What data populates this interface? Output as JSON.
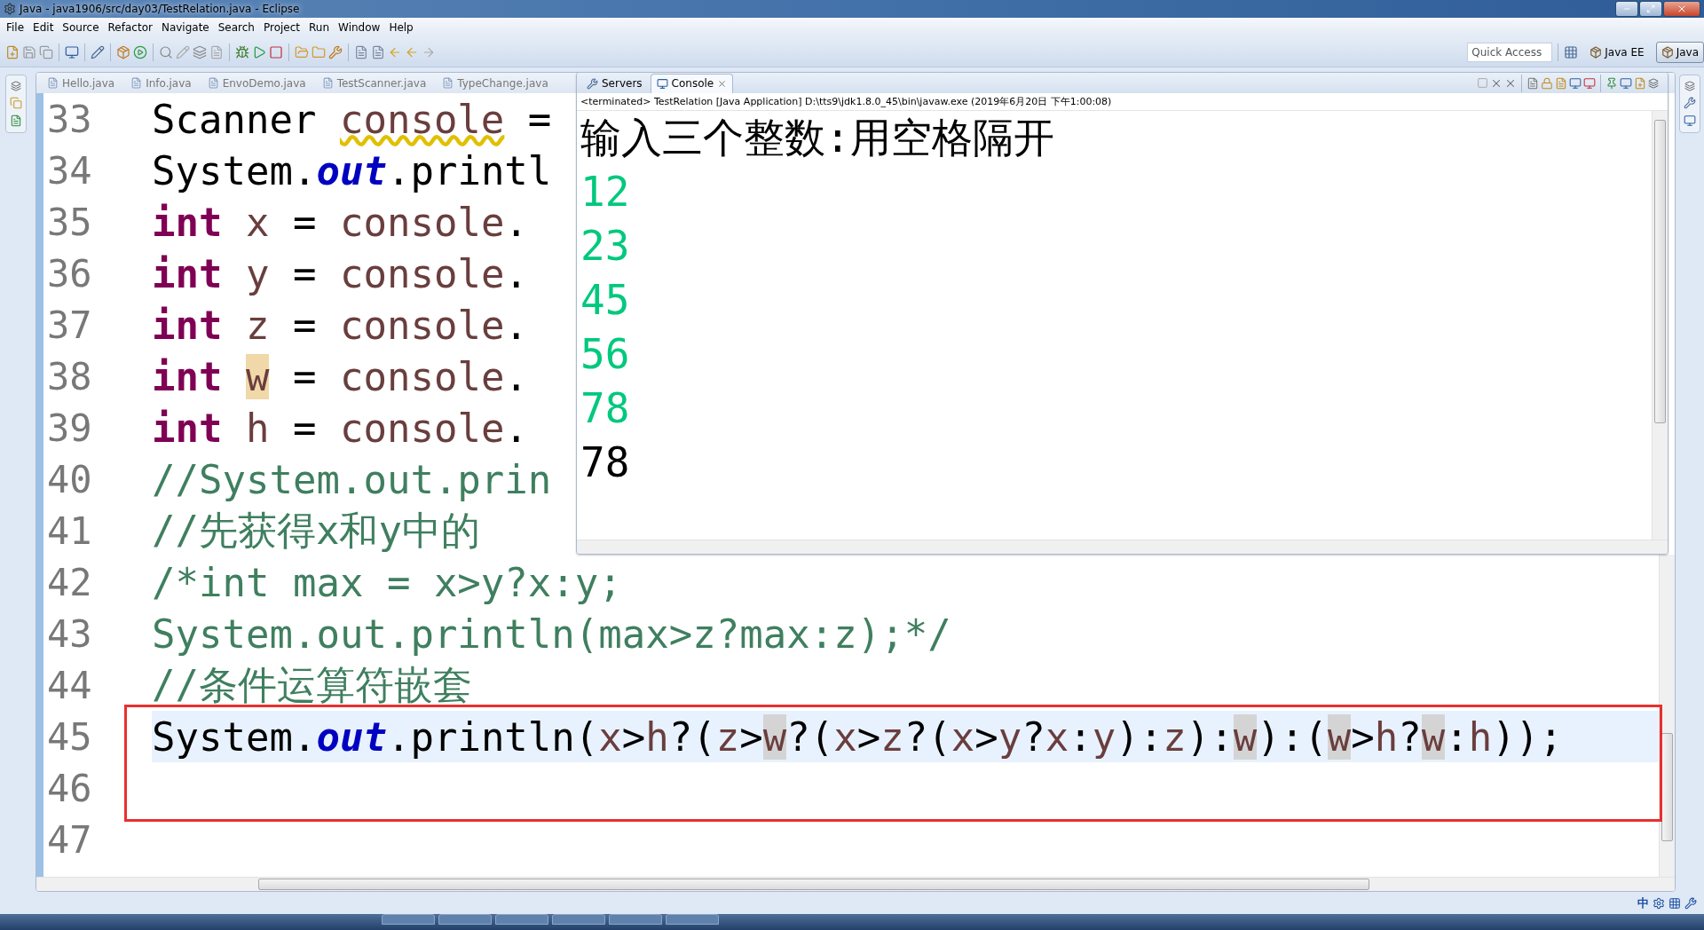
{
  "window": {
    "title": "Java - java1906/src/day03/TestRelation.java - Eclipse"
  },
  "menu": [
    "File",
    "Edit",
    "Source",
    "Refactor",
    "Navigate",
    "Search",
    "Project",
    "Run",
    "Window",
    "Help"
  ],
  "quick_access": {
    "placeholder": "Quick Access"
  },
  "perspectives": [
    {
      "label": "Java EE",
      "selected": false
    },
    {
      "label": "Java",
      "selected": true
    }
  ],
  "editor_tabs": [
    {
      "label": "Hello.java",
      "selected": false
    },
    {
      "label": "Info.java",
      "selected": false
    },
    {
      "label": "EnvoDemo.java",
      "selected": false
    },
    {
      "label": "TestScanner.java",
      "selected": false
    },
    {
      "label": "TypeChange.java",
      "selected": false
    }
  ],
  "editor": {
    "lines": [
      {
        "number": "33",
        "current": false,
        "boxed": false,
        "tokens": [
          {
            "text": "Scanner ",
            "kind": "plain"
          },
          {
            "text": "console",
            "kind": "local-warning"
          },
          {
            "text": " =",
            "kind": "plain"
          }
        ]
      },
      {
        "number": "34",
        "current": false,
        "boxed": false,
        "tokens": [
          {
            "text": "System.",
            "kind": "plain"
          },
          {
            "text": "out",
            "kind": "field"
          },
          {
            "text": ".printl",
            "kind": "plain"
          }
        ]
      },
      {
        "number": "35",
        "current": false,
        "boxed": false,
        "tokens": [
          {
            "text": "int",
            "kind": "keyword"
          },
          {
            "text": "x",
            "kind": "local"
          },
          {
            "text": " = ",
            "kind": "plain"
          },
          {
            "text": "console",
            "kind": "local"
          },
          {
            "text": ".",
            "kind": "plain"
          }
        ]
      },
      {
        "number": "36",
        "current": false,
        "boxed": false,
        "tokens": [
          {
            "text": "int",
            "kind": "keyword"
          },
          {
            "text": "y",
            "kind": "local"
          },
          {
            "text": " = ",
            "kind": "plain"
          },
          {
            "text": "console",
            "kind": "local"
          },
          {
            "text": ".",
            "kind": "plain"
          }
        ]
      },
      {
        "number": "37",
        "current": false,
        "boxed": false,
        "tokens": [
          {
            "text": "int",
            "kind": "keyword"
          },
          {
            "text": "z",
            "kind": "local"
          },
          {
            "text": " = ",
            "kind": "plain"
          },
          {
            "text": "console",
            "kind": "local"
          },
          {
            "text": ".",
            "kind": "plain"
          }
        ]
      },
      {
        "number": "38",
        "current": false,
        "boxed": false,
        "tokens": [
          {
            "text": "int",
            "kind": "keyword"
          },
          {
            "text": "w",
            "kind": "local-write"
          },
          {
            "text": " = ",
            "kind": "plain"
          },
          {
            "text": "console",
            "kind": "local"
          },
          {
            "text": ".",
            "kind": "plain"
          }
        ]
      },
      {
        "number": "39",
        "current": false,
        "boxed": false,
        "tokens": [
          {
            "text": "int",
            "kind": "keyword"
          },
          {
            "text": "h",
            "kind": "local"
          },
          {
            "text": " = ",
            "kind": "plain"
          },
          {
            "text": "console",
            "kind": "local"
          },
          {
            "text": ".",
            "kind": "plain"
          }
        ]
      },
      {
        "number": "40",
        "current": false,
        "boxed": false,
        "tokens": [
          {
            "text": "//System.out.prin",
            "kind": "comment"
          }
        ]
      },
      {
        "number": "41",
        "current": false,
        "boxed": false,
        "tokens": [
          {
            "text": "//先获得x和y中的",
            "kind": "comment"
          }
        ]
      },
      {
        "number": "42",
        "current": false,
        "boxed": false,
        "tokens": [
          {
            "text": "/*int max = x>y?x:y;",
            "kind": "comment"
          }
        ]
      },
      {
        "number": "43",
        "current": false,
        "boxed": false,
        "tokens": [
          {
            "text": "System.out.println(max>z?max:z);*/",
            "kind": "comment"
          }
        ]
      },
      {
        "number": "44",
        "current": false,
        "boxed": false,
        "tokens": [
          {
            "text": "//条件运算符嵌套",
            "kind": "comment"
          }
        ]
      },
      {
        "number": "45",
        "current": true,
        "boxed": true,
        "tokens": [
          {
            "text": "System.",
            "kind": "plain"
          },
          {
            "text": "out",
            "kind": "field"
          },
          {
            "text": ".println(",
            "kind": "plain"
          },
          {
            "text": "x",
            "kind": "local"
          },
          {
            "text": ">",
            "kind": "plain"
          },
          {
            "text": "h",
            "kind": "local"
          },
          {
            "text": "?(",
            "kind": "plain"
          },
          {
            "text": "z",
            "kind": "local"
          },
          {
            "text": ">",
            "kind": "plain"
          },
          {
            "text": "w",
            "kind": "local-read"
          },
          {
            "text": "?(",
            "kind": "plain"
          },
          {
            "text": "x",
            "kind": "local"
          },
          {
            "text": ">",
            "kind": "plain"
          },
          {
            "text": "z",
            "kind": "local"
          },
          {
            "text": "?(",
            "kind": "plain"
          },
          {
            "text": "x",
            "kind": "local"
          },
          {
            "text": ">",
            "kind": "plain"
          },
          {
            "text": "y",
            "kind": "local"
          },
          {
            "text": "?",
            "kind": "plain"
          },
          {
            "text": "x",
            "kind": "local"
          },
          {
            "text": ":",
            "kind": "plain"
          },
          {
            "text": "y",
            "kind": "local"
          },
          {
            "text": "):",
            "kind": "plain"
          },
          {
            "text": "z",
            "kind": "local"
          },
          {
            "text": "):",
            "kind": "plain"
          },
          {
            "text": "w",
            "kind": "local-read"
          },
          {
            "text": "):(",
            "kind": "plain"
          },
          {
            "text": "w",
            "kind": "local-read"
          },
          {
            "text": ">",
            "kind": "plain"
          },
          {
            "text": "h",
            "kind": "local"
          },
          {
            "text": "?",
            "kind": "plain"
          },
          {
            "text": "w",
            "kind": "local-read"
          },
          {
            "text": ":",
            "kind": "plain"
          },
          {
            "text": "h",
            "kind": "local"
          },
          {
            "text": "));",
            "kind": "plain"
          }
        ]
      },
      {
        "number": "46",
        "current": false,
        "boxed": true
      },
      {
        "number": "47",
        "current": false,
        "boxed": false
      }
    ]
  },
  "console": {
    "tabs": [
      {
        "label": "Servers",
        "selected": false
      },
      {
        "label": "Console",
        "selected": true
      }
    ],
    "header": "<terminated> TestRelation [Java Application] D:\\tts9\\jdk1.8.0_45\\bin\\javaw.exe (2019年6月20日 下午1:00:08)",
    "lines": [
      {
        "text": "输入三个整数:用空格隔开",
        "kind": "output"
      },
      {
        "text": "12",
        "kind": "input"
      },
      {
        "text": "23",
        "kind": "input"
      },
      {
        "text": "45",
        "kind": "input"
      },
      {
        "text": "56",
        "kind": "input"
      },
      {
        "text": "78",
        "kind": "input"
      },
      {
        "text": "78",
        "kind": "output"
      }
    ]
  },
  "status_bar": {
    "ime": "中"
  }
}
